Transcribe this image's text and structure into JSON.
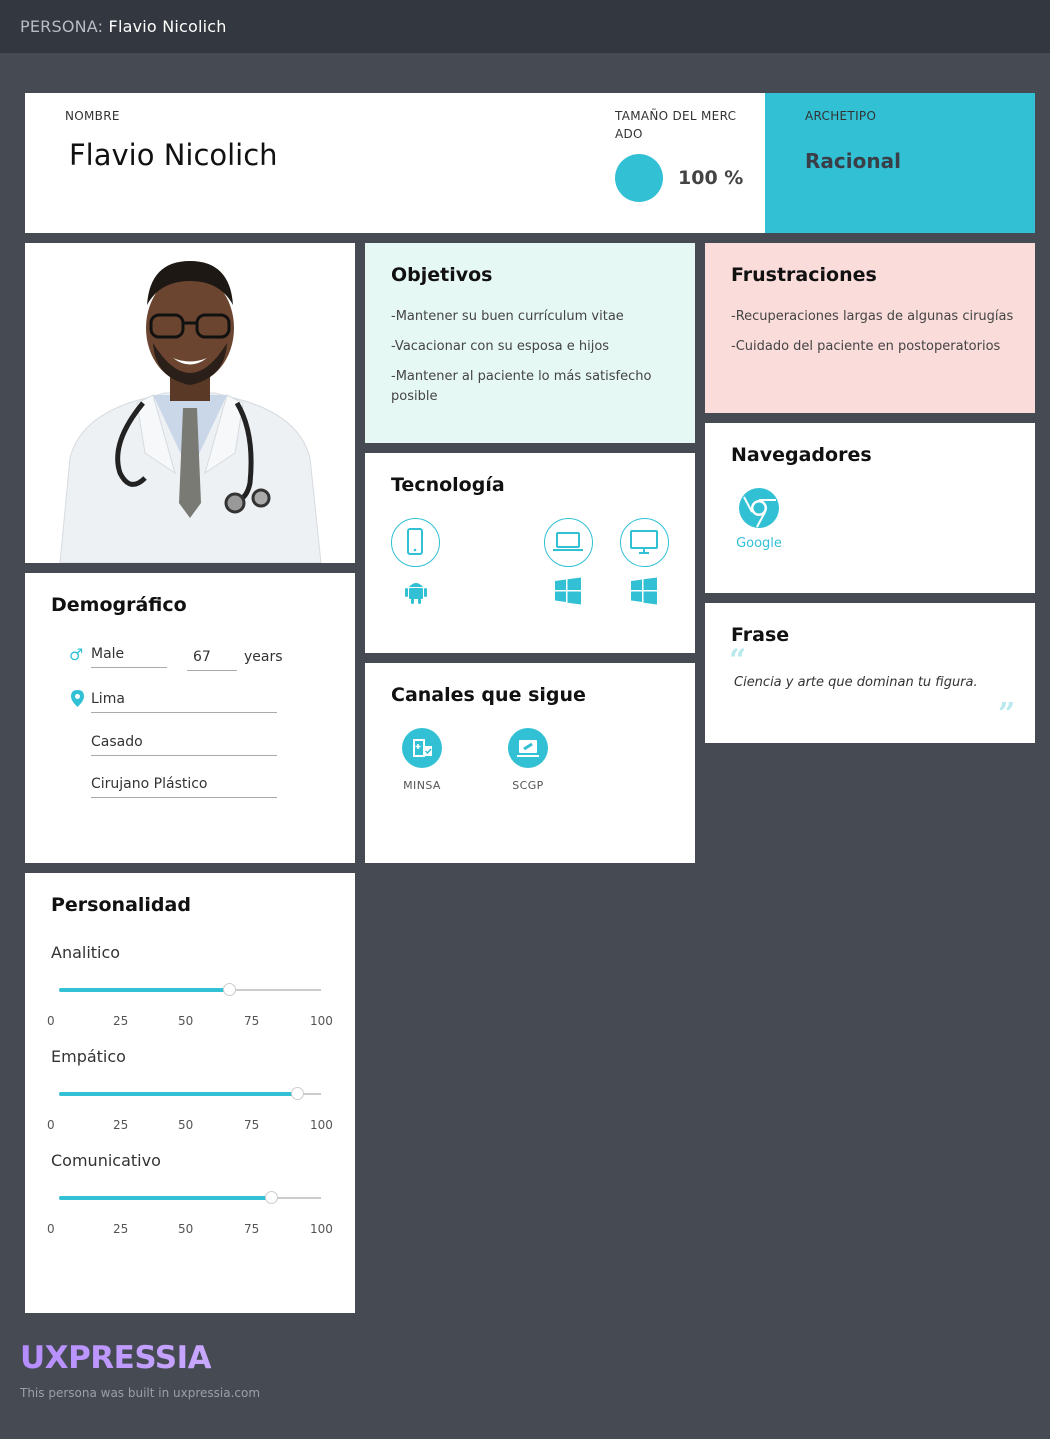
{
  "topbar": {
    "prefix": "PERSONA:",
    "name": "Flavio Nicolich"
  },
  "header": {
    "name_label": "NOMBRE",
    "name": "Flavio Nicolich",
    "market_label_1": "TAMAÑO DEL MERC",
    "market_label_2": "ADO",
    "market_value": "100 %",
    "market_fraction": 1.0,
    "archetype_label": "ARCHETIPO",
    "archetype": "Racional"
  },
  "objectives": {
    "title": "Objetivos",
    "items": [
      "-Mantener su buen currículum vitae",
      "-Vacacionar con su esposa e hijos",
      "-Mantener al paciente lo más satisfecho posible"
    ]
  },
  "frustrations": {
    "title": "Frustraciones",
    "items": [
      "-Recuperaciones largas de algunas cirugías",
      "-Cuidado del paciente en postoperatorios"
    ]
  },
  "technology": {
    "title": "Tecnología",
    "devices": [
      {
        "icon": "smartphone-icon",
        "os": "android-icon"
      },
      {
        "icon": "laptop-icon",
        "os": "windows-icon"
      },
      {
        "icon": "desktop-icon",
        "os": "windows-icon"
      }
    ]
  },
  "browsers": {
    "title": "Navegadores",
    "items": [
      {
        "icon": "chrome-icon",
        "label": "Google"
      }
    ]
  },
  "demographic": {
    "title": "Demográfico",
    "gender": "Male",
    "age": "67",
    "age_unit": "years",
    "location": "Lima",
    "status": "Casado",
    "occupation": "Cirujano Plástico"
  },
  "channels": {
    "title": "Canales que sigue",
    "items": [
      {
        "icon": "hospital-icon",
        "label": "MINSA"
      },
      {
        "icon": "clinic-icon",
        "label": "SCGP"
      }
    ]
  },
  "quote": {
    "title": "Frase",
    "text": "Ciencia y arte que dominan tu figura."
  },
  "personality": {
    "title": "Personalidad",
    "ticks": [
      "0",
      "25",
      "50",
      "75",
      "100"
    ],
    "traits": [
      {
        "label": "Analitico",
        "value": 65
      },
      {
        "label": "Empático",
        "value": 91
      },
      {
        "label": "Comunicativo",
        "value": 81
      }
    ]
  },
  "footer": {
    "logo": "UXPRESSIA",
    "text": "This persona was built in uxpressia.com"
  },
  "colors": {
    "accent": "#32c0d5",
    "objectives_bg": "#e6f8f4",
    "frustrations_bg": "#fadcda",
    "background": "#454a53"
  }
}
